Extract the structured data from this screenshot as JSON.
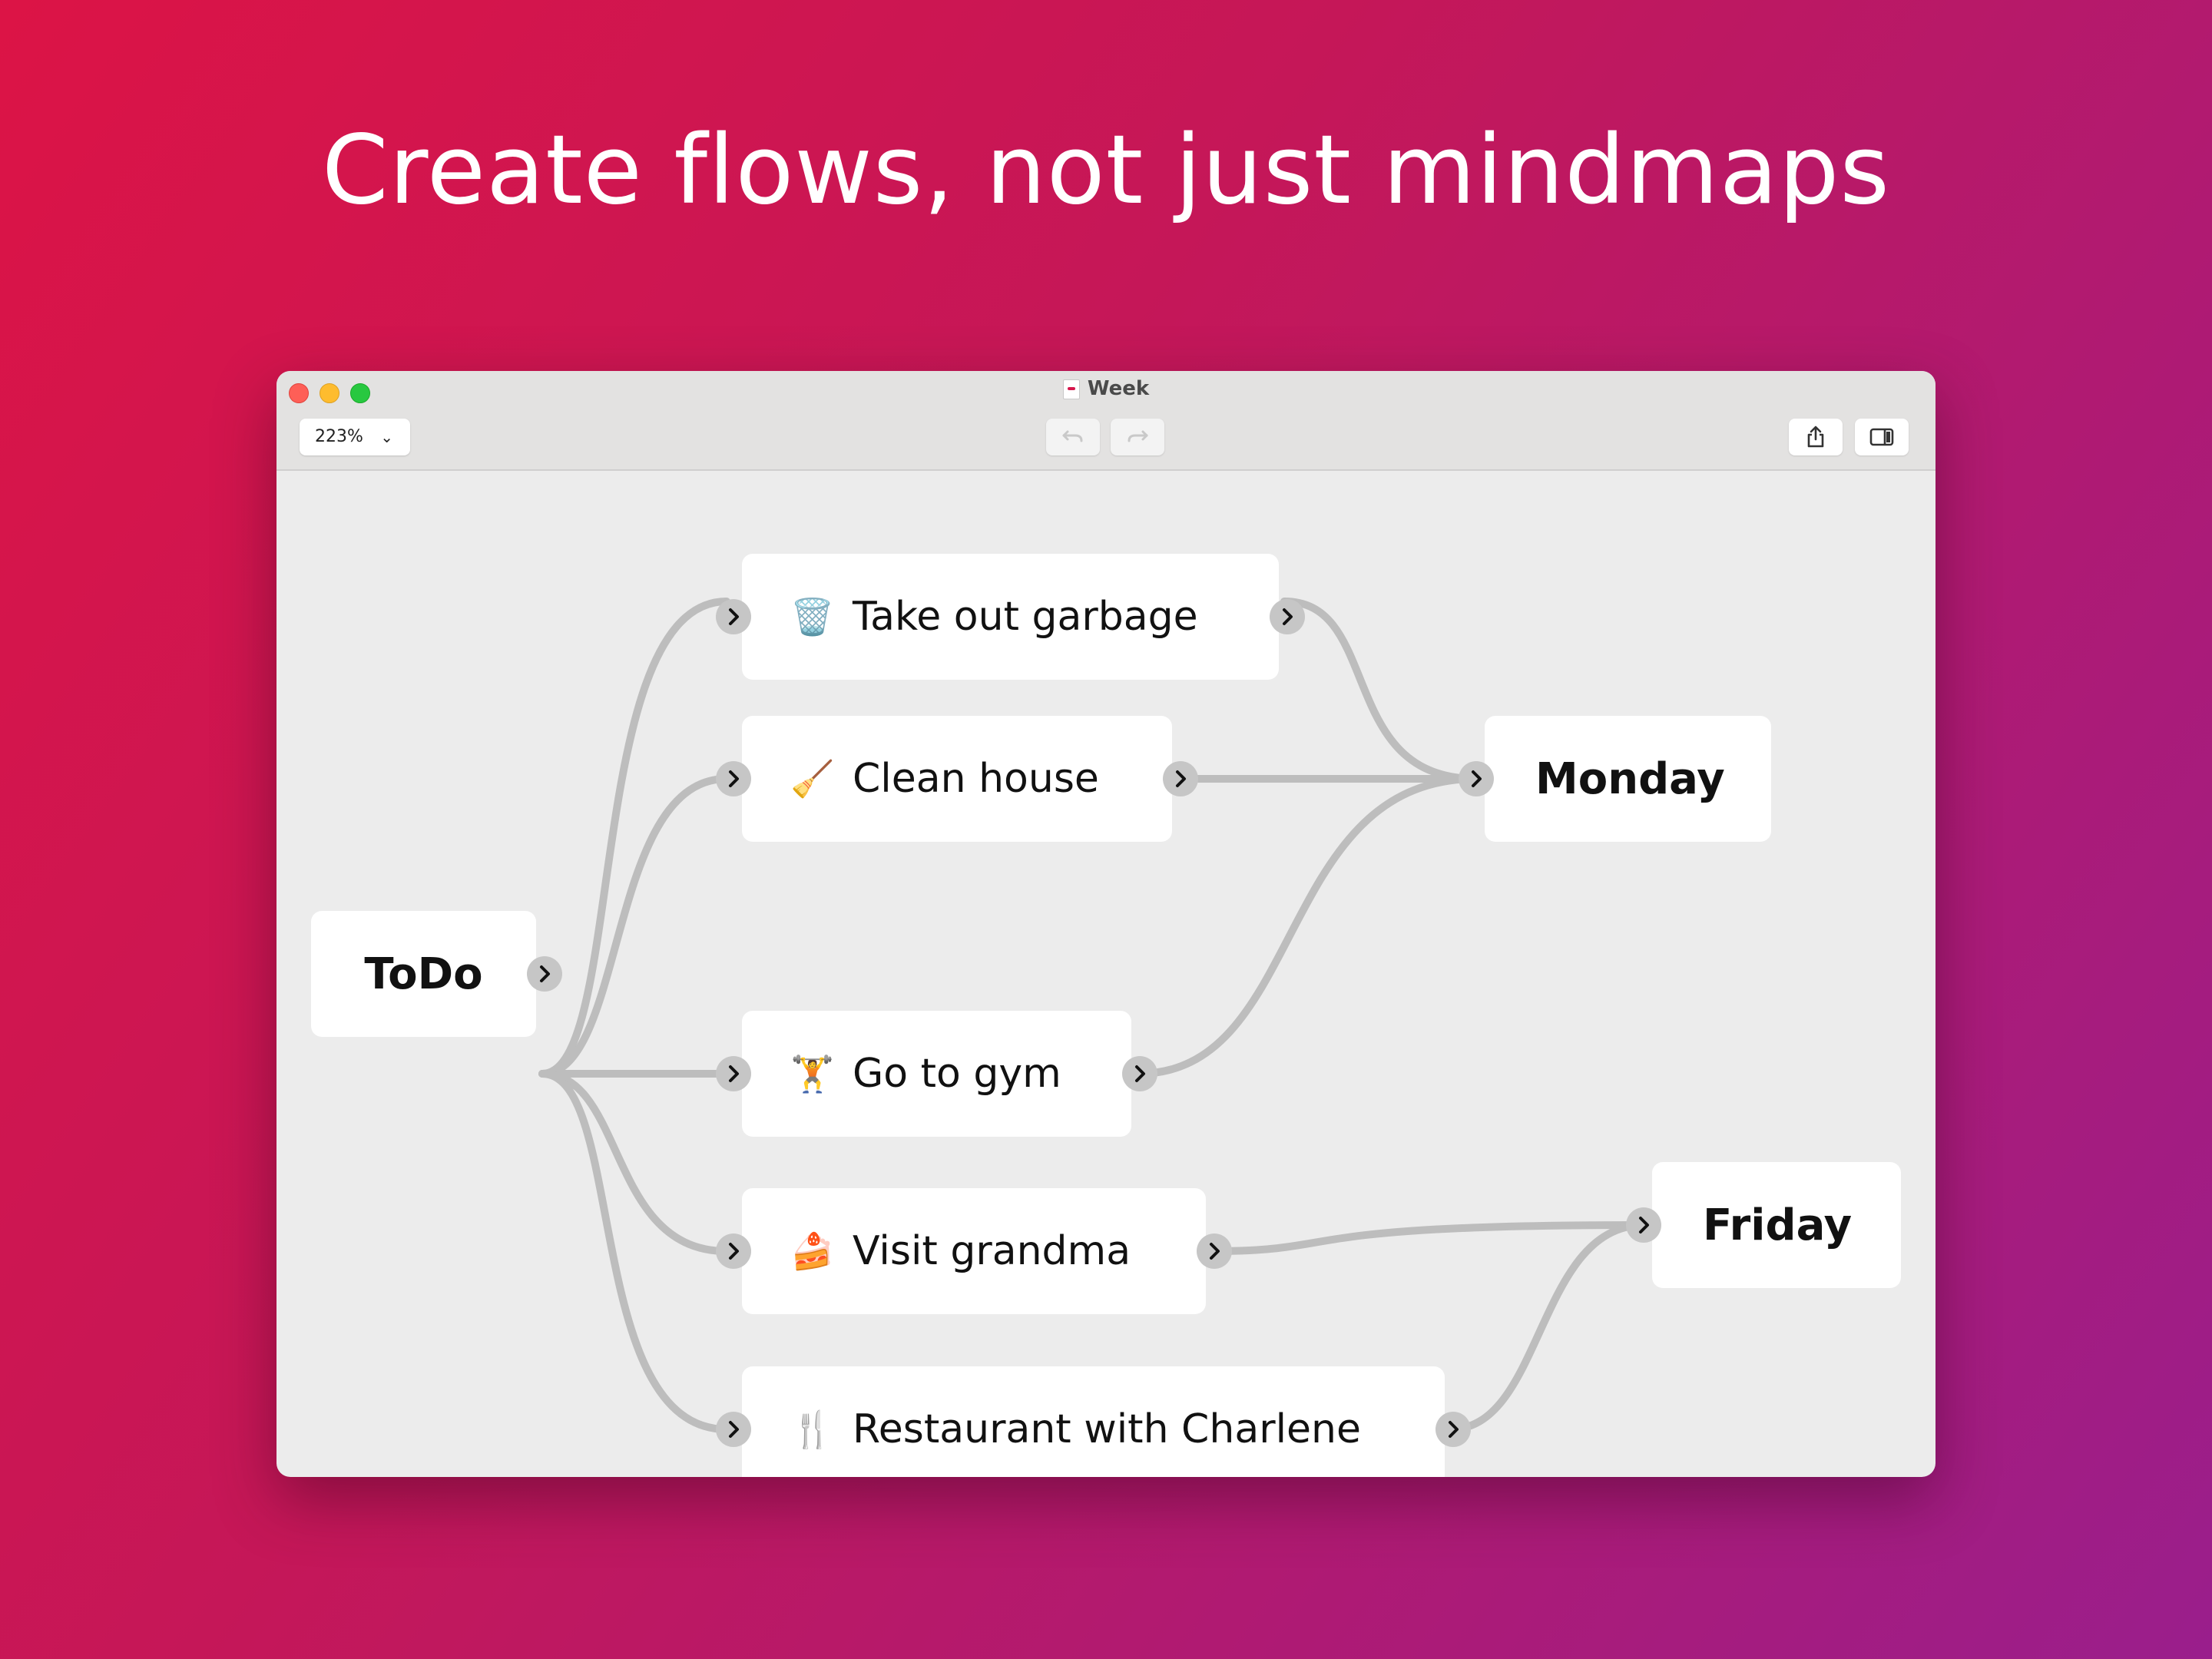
{
  "headline": "Create flows, not just mindmaps",
  "window": {
    "title": "Week",
    "zoom_label": "223%"
  },
  "toolbar": {
    "undo_icon": "undo-arrow-icon",
    "redo_icon": "redo-arrow-icon",
    "share_icon": "share-icon",
    "sidebar_icon": "sidebar-toggle-icon"
  },
  "nodes": {
    "todo": {
      "label": "ToDo"
    },
    "garbage": {
      "label": "Take out garbage",
      "emoji": "🗑️",
      "icon": "wastebasket-icon"
    },
    "clean": {
      "label": "Clean house",
      "emoji": "🧹",
      "icon": "broom-icon"
    },
    "gym": {
      "label": "Go to gym",
      "emoji": "🏋️",
      "icon": "weightlifter-icon"
    },
    "grandma": {
      "label": "Visit grandma",
      "emoji": "🍰",
      "icon": "cake-icon"
    },
    "restaurant": {
      "label": "Restaurant with Charlene",
      "emoji": "🍴",
      "icon": "fork-and-knife-icon"
    },
    "monday": {
      "label": "Monday"
    },
    "friday": {
      "label": "Friday"
    }
  },
  "colors": {
    "link": "#bdbdbd",
    "port": "#c6c6c6",
    "canvas": "#ececec"
  }
}
